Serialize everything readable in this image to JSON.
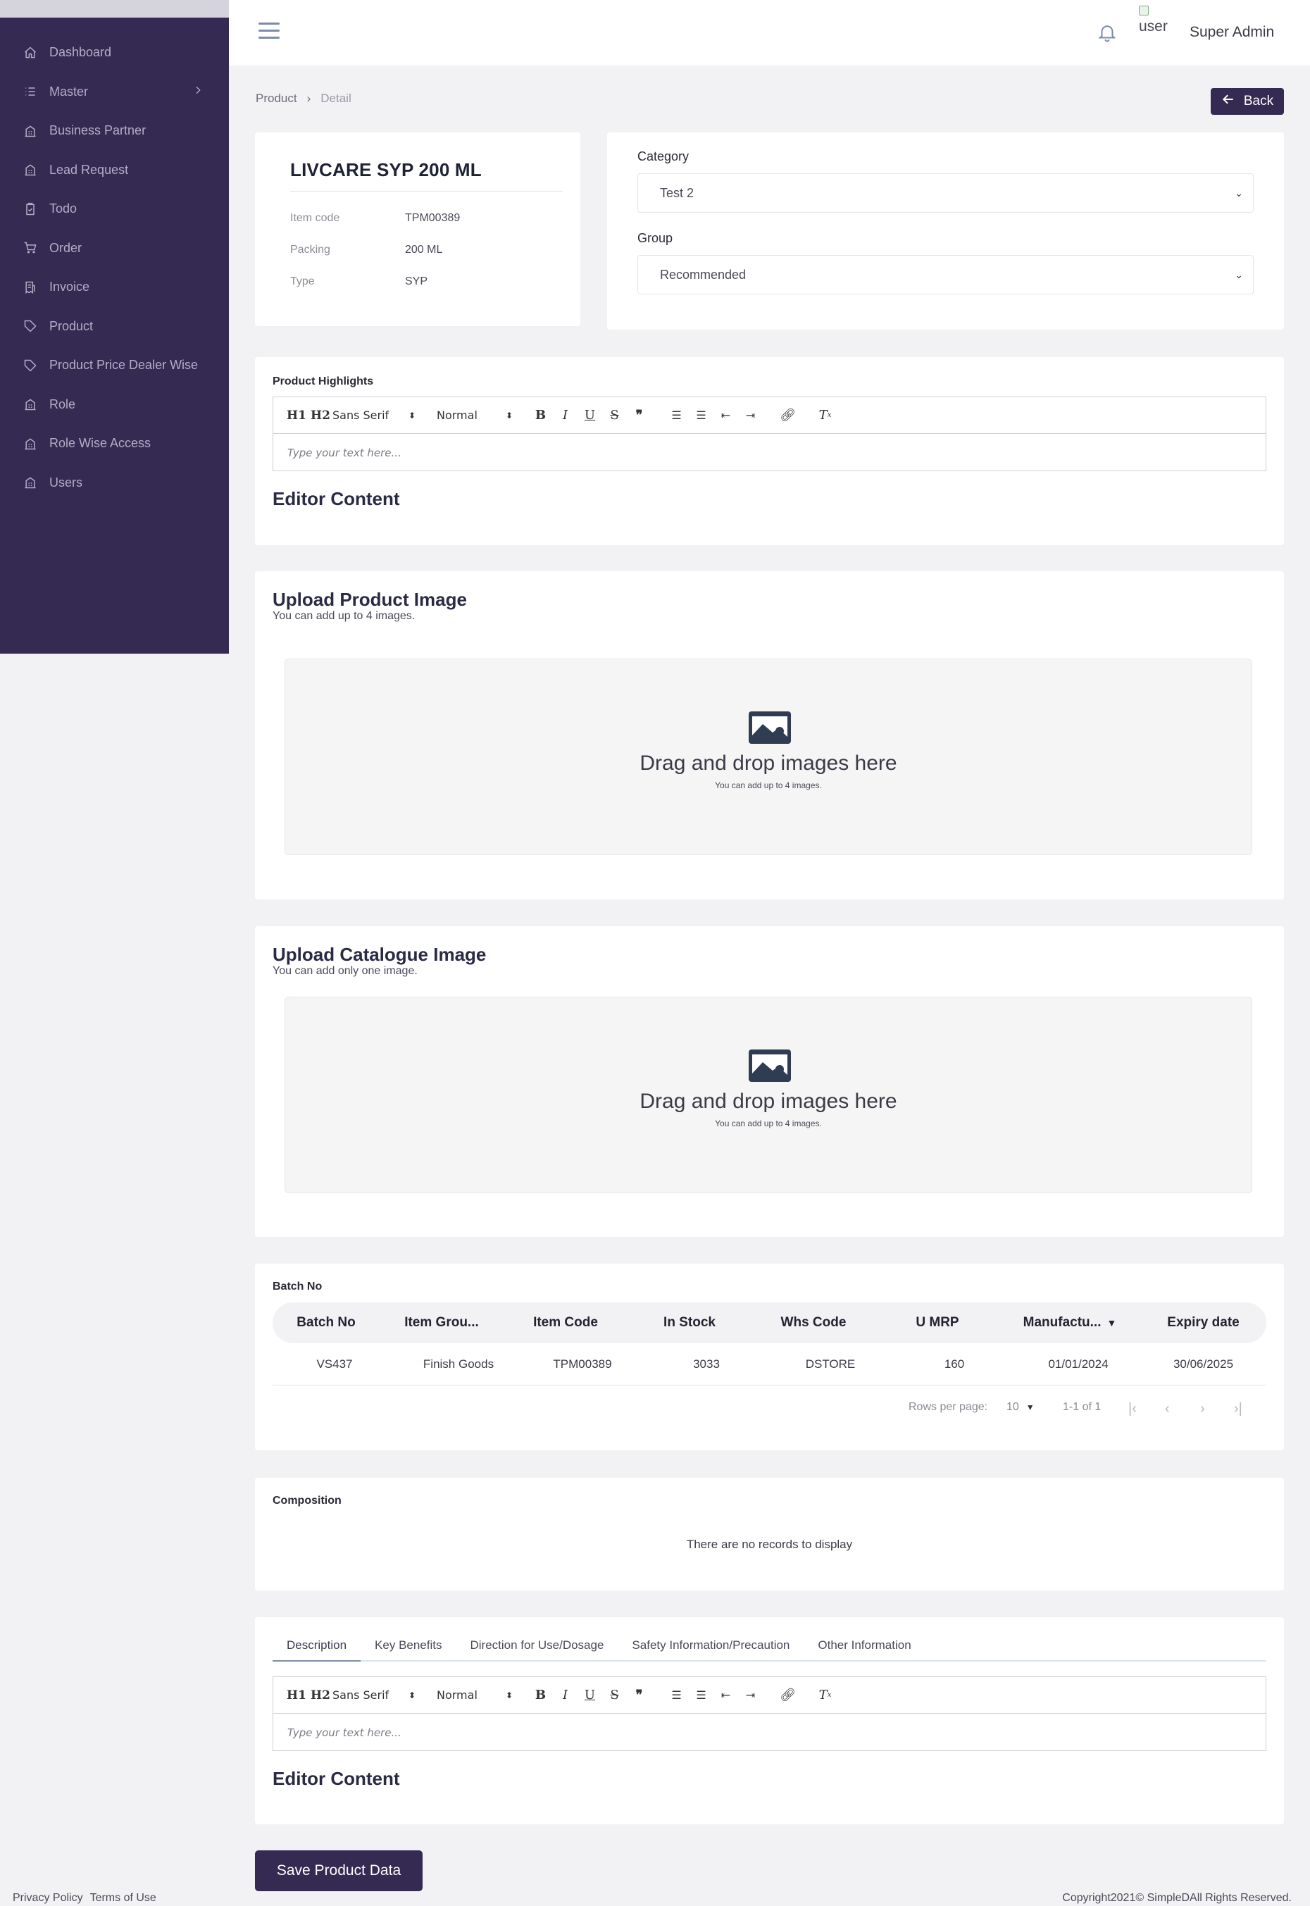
{
  "sidebar": {
    "items": [
      {
        "label": "Dashboard",
        "icon": "home-icon"
      },
      {
        "label": "Master",
        "icon": "list-icon",
        "has_children": true
      },
      {
        "label": "Business Partner",
        "icon": "building-icon"
      },
      {
        "label": "Lead Request",
        "icon": "building-icon"
      },
      {
        "label": "Todo",
        "icon": "clipboard-check-icon"
      },
      {
        "label": "Order",
        "icon": "cart-icon"
      },
      {
        "label": "Invoice",
        "icon": "receipt-icon"
      },
      {
        "label": "Product",
        "icon": "tag-icon"
      },
      {
        "label": "Product Price Dealer Wise",
        "icon": "tag-icon"
      },
      {
        "label": "Role",
        "icon": "building-icon"
      },
      {
        "label": "Role Wise Access",
        "icon": "building-icon"
      },
      {
        "label": "Users",
        "icon": "building-icon"
      }
    ]
  },
  "header": {
    "user_img_alt": "user",
    "user_name": "Super Admin"
  },
  "breadcrumb": {
    "parent": "Product",
    "current": "Detail"
  },
  "back_label": "Back",
  "product": {
    "title": "LIVCARE SYP 200 ML",
    "specs": [
      {
        "label": "Item code",
        "value": "TPM00389"
      },
      {
        "label": "Packing",
        "value": "200 ML"
      },
      {
        "label": "Type",
        "value": "SYP"
      }
    ]
  },
  "classification": {
    "category_label": "Category",
    "category_value": "Test 2",
    "group_label": "Group",
    "group_value": "Recommended"
  },
  "editor_toolbar": {
    "h1": "H1",
    "h2": "H2",
    "font": "Sans Serif",
    "size": "Normal",
    "placeholder": "Type your text here..."
  },
  "highlights": {
    "label": "Product Highlights",
    "content_heading": "Editor Content"
  },
  "upload_product": {
    "title": "Upload Product Image",
    "subtitle": "You can add up to 4 images.",
    "drop_text": "Drag and drop images here",
    "drop_sub": "You can add up to 4 images."
  },
  "upload_catalogue": {
    "title": "Upload Catalogue Image",
    "subtitle": "You can add only one image.",
    "drop_text": "Drag and drop images here",
    "drop_sub": "You can add up to 4 images."
  },
  "batch": {
    "label": "Batch No",
    "columns": [
      "Batch No",
      "Item Grou...",
      "Item Code",
      "In Stock",
      "Whs Code",
      "U MRP",
      "Manufactu...",
      "Expiry date"
    ],
    "rows": [
      [
        "VS437",
        "Finish Goods",
        "TPM00389",
        "3033",
        "DSTORE",
        "160",
        "01/01/2024",
        "30/06/2025"
      ]
    ],
    "rows_per_page_label": "Rows per page:",
    "rows_per_page": "10",
    "range": "1-1 of 1"
  },
  "composition": {
    "label": "Composition",
    "empty": "There are no records to display"
  },
  "info_tabs": {
    "tabs": [
      "Description",
      "Key Benefits",
      "Direction for Use/Dosage",
      "Safety Information/Precaution",
      "Other Information"
    ],
    "active": "Description",
    "content_heading": "Editor Content"
  },
  "save_label": "Save Product Data",
  "footer": {
    "privacy": "Privacy Policy",
    "terms": "Terms of Use",
    "copyright": "Copyright2021© SimpleDAll Rights Reserved."
  }
}
